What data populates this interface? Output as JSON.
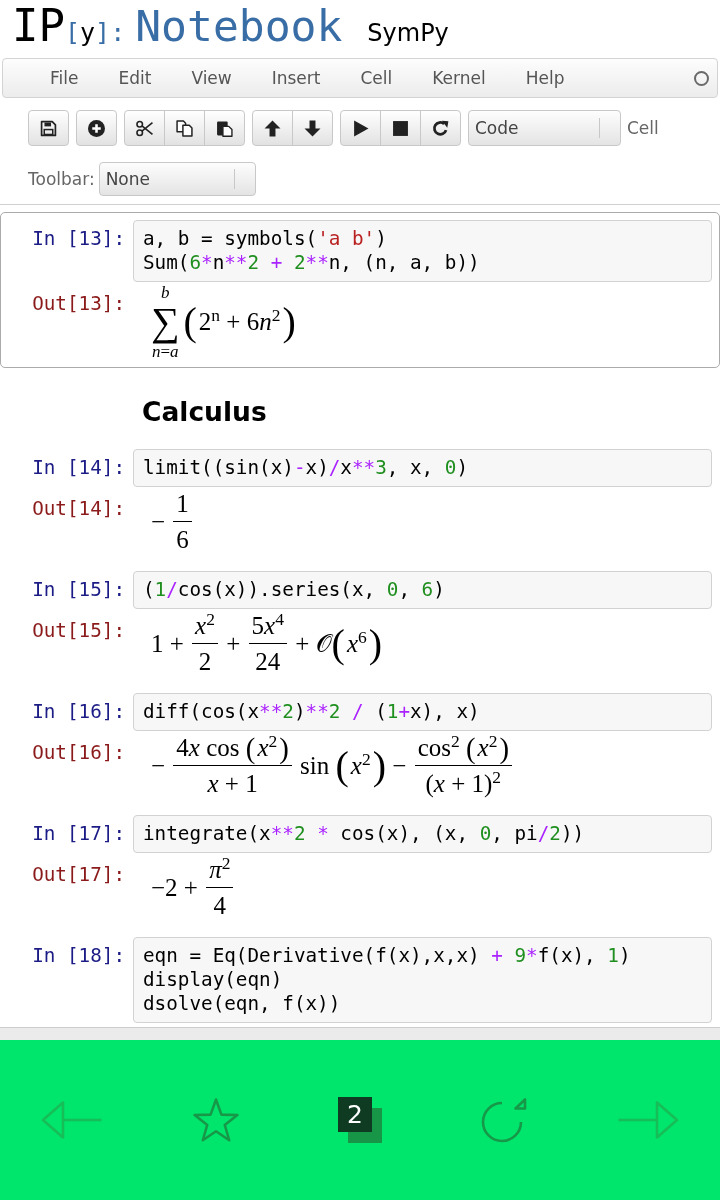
{
  "header": {
    "logo_mark": [
      {
        "kind": "ip",
        "text": "IP"
      },
      {
        "kind": "bracket",
        "text": "["
      },
      {
        "kind": "y",
        "text": "y"
      },
      {
        "kind": "bracket",
        "text": "]:"
      }
    ],
    "logo_text": "Notebook",
    "notebook_name": "SymPy"
  },
  "menu": {
    "items": [
      "File",
      "Edit",
      "View",
      "Insert",
      "Cell",
      "Kernel",
      "Help"
    ],
    "kernel_busy": false
  },
  "toolbar": {
    "groups": [
      [
        {
          "kind": "save"
        }
      ],
      [
        {
          "kind": "insert"
        }
      ],
      [
        {
          "kind": "cut"
        },
        {
          "kind": "copy"
        },
        {
          "kind": "paste"
        }
      ],
      [
        {
          "kind": "up"
        },
        {
          "kind": "down"
        }
      ],
      [
        {
          "kind": "run"
        },
        {
          "kind": "stop"
        },
        {
          "kind": "restart"
        }
      ]
    ],
    "cell_type": "Code",
    "cell_type_label": "Cell",
    "preset_label": "Toolbar:",
    "preset": "None"
  },
  "cells": [
    {
      "kind": "code",
      "selected": true,
      "prompt_in": "In [13]:",
      "code": [
        [
          {
            "kind": "name",
            "text": "a, b = symbols("
          },
          {
            "kind": "string",
            "text": "'a b'"
          },
          {
            "kind": "name",
            "text": ")"
          }
        ],
        [
          {
            "kind": "name",
            "text": "Sum("
          },
          {
            "kind": "number",
            "text": "6"
          },
          {
            "kind": "operator",
            "text": "*"
          },
          {
            "kind": "name",
            "text": "n"
          },
          {
            "kind": "operator",
            "text": "**"
          },
          {
            "kind": "number",
            "text": "2"
          },
          {
            "kind": "operator",
            "text": " + "
          },
          {
            "kind": "number",
            "text": "2"
          },
          {
            "kind": "operator",
            "text": "**"
          },
          {
            "kind": "name",
            "text": "n, (n, a, b))"
          }
        ]
      ],
      "prompt_out": "Out[13]:",
      "output": [
        {
          "kind": "sum",
          "symbol": "∑",
          "upper": "b",
          "lower": "*n*=*a*"
        },
        {
          "kind": "group",
          "open": "(",
          "close": ")",
          "body": [
            {
              "kind": "text",
              "text": "2$^{n}$ + 6"
            },
            {
              "kind": "text",
              "text": "*n*$^{2}$"
            }
          ]
        }
      ]
    },
    {
      "kind": "heading",
      "selected": false,
      "text": "Calculus"
    },
    {
      "kind": "code",
      "selected": false,
      "prompt_in": "In [14]:",
      "code": [
        [
          {
            "kind": "name",
            "text": "limit((sin(x)"
          },
          {
            "kind": "operator",
            "text": "-"
          },
          {
            "kind": "name",
            "text": "x)"
          },
          {
            "kind": "operator",
            "text": "/"
          },
          {
            "kind": "name",
            "text": "x"
          },
          {
            "kind": "operator",
            "text": "**"
          },
          {
            "kind": "number",
            "text": "3"
          },
          {
            "kind": "name",
            "text": ", x, "
          },
          {
            "kind": "number",
            "text": "0"
          },
          {
            "kind": "name",
            "text": ")"
          }
        ]
      ],
      "prompt_out": "Out[14]:",
      "output": [
        {
          "kind": "text",
          "text": "− "
        },
        {
          "kind": "frac",
          "num": [
            {
              "kind": "text",
              "text": "1"
            }
          ],
          "den": [
            {
              "kind": "text",
              "text": "6"
            }
          ]
        }
      ]
    },
    {
      "kind": "code",
      "selected": false,
      "prompt_in": "In [15]:",
      "code": [
        [
          {
            "kind": "name",
            "text": "("
          },
          {
            "kind": "number",
            "text": "1"
          },
          {
            "kind": "operator",
            "text": "/"
          },
          {
            "kind": "name",
            "text": "cos(x)).series(x, "
          },
          {
            "kind": "number",
            "text": "0"
          },
          {
            "kind": "name",
            "text": ", "
          },
          {
            "kind": "number",
            "text": "6"
          },
          {
            "kind": "name",
            "text": ")"
          }
        ]
      ],
      "prompt_out": "Out[15]:",
      "output": [
        {
          "kind": "text",
          "text": "1 + "
        },
        {
          "kind": "frac",
          "num": [
            {
              "kind": "text",
              "text": "*x*$^{2}$"
            }
          ],
          "den": [
            {
              "kind": "text",
              "text": "2"
            }
          ]
        },
        {
          "kind": "text",
          "text": " + "
        },
        {
          "kind": "frac",
          "num": [
            {
              "kind": "text",
              "text": "5"
            },
            {
              "kind": "text",
              "text": "*x*$^{4}$"
            }
          ],
          "den": [
            {
              "kind": "text",
              "text": "24"
            }
          ]
        },
        {
          "kind": "text",
          "text": " + 𝒪"
        },
        {
          "kind": "group",
          "open": "(",
          "close": ")",
          "body": [
            {
              "kind": "text",
              "text": "*x*$^{6}$"
            }
          ]
        }
      ]
    },
    {
      "kind": "code",
      "selected": false,
      "prompt_in": "In [16]:",
      "code": [
        [
          {
            "kind": "name",
            "text": "diff(cos(x"
          },
          {
            "kind": "operator",
            "text": "**"
          },
          {
            "kind": "number",
            "text": "2"
          },
          {
            "kind": "name",
            "text": ")"
          },
          {
            "kind": "operator",
            "text": "**"
          },
          {
            "kind": "number",
            "text": "2"
          },
          {
            "kind": "operator",
            "text": " / "
          },
          {
            "kind": "name",
            "text": "("
          },
          {
            "kind": "number",
            "text": "1"
          },
          {
            "kind": "operator",
            "text": "+"
          },
          {
            "kind": "name",
            "text": "x), x)"
          }
        ]
      ],
      "prompt_out": "Out[16]:",
      "output": [
        {
          "kind": "text",
          "text": "− "
        },
        {
          "kind": "frac",
          "num": [
            {
              "kind": "text",
              "text": "4"
            },
            {
              "kind": "text",
              "text": "*x* cos "
            },
            {
              "kind": "group",
              "open": "(",
              "close": ")",
              "body": [
                {
                  "kind": "text",
                  "text": "*x*$^{2}$"
                }
              ]
            }
          ],
          "den": [
            {
              "kind": "text",
              "text": "*x* + 1"
            }
          ]
        },
        {
          "kind": "text",
          "text": " sin "
        },
        {
          "kind": "group",
          "open": "(",
          "close": ")",
          "body": [
            {
              "kind": "text",
              "text": "*x*$^{2}$"
            }
          ]
        },
        {
          "kind": "text",
          "text": " − "
        },
        {
          "kind": "frac",
          "num": [
            {
              "kind": "text",
              "text": "cos$^{2}$ "
            },
            {
              "kind": "group",
              "open": "(",
              "close": ")",
              "body": [
                {
                  "kind": "text",
                  "text": "*x*$^{2}$"
                }
              ]
            }
          ],
          "den": [
            {
              "kind": "text",
              "text": "(*x* + 1)$^{2}$"
            }
          ]
        }
      ]
    },
    {
      "kind": "code",
      "selected": false,
      "prompt_in": "In [17]:",
      "code": [
        [
          {
            "kind": "name",
            "text": "integrate(x"
          },
          {
            "kind": "operator",
            "text": "**"
          },
          {
            "kind": "number",
            "text": "2"
          },
          {
            "kind": "operator",
            "text": " * "
          },
          {
            "kind": "name",
            "text": "cos(x), (x, "
          },
          {
            "kind": "number",
            "text": "0"
          },
          {
            "kind": "name",
            "text": ", pi"
          },
          {
            "kind": "operator",
            "text": "/"
          },
          {
            "kind": "number",
            "text": "2"
          },
          {
            "kind": "name",
            "text": "))"
          }
        ]
      ],
      "prompt_out": "Out[17]:",
      "output": [
        {
          "kind": "text",
          "text": "−2 + "
        },
        {
          "kind": "frac",
          "num": [
            {
              "kind": "text",
              "text": "*π*$^{2}$"
            }
          ],
          "den": [
            {
              "kind": "text",
              "text": "4"
            }
          ]
        }
      ]
    },
    {
      "kind": "code",
      "selected": false,
      "prompt_in": "In [18]:",
      "code": [
        [
          {
            "kind": "name",
            "text": "eqn = Eq(Derivative(f(x),x,x)"
          },
          {
            "kind": "operator",
            "text": " + "
          },
          {
            "kind": "number",
            "text": "9"
          },
          {
            "kind": "operator",
            "text": "*"
          },
          {
            "kind": "name",
            "text": "f(x), "
          },
          {
            "kind": "number",
            "text": "1"
          },
          {
            "kind": "name",
            "text": ")"
          }
        ],
        [
          {
            "kind": "name",
            "text": "display(eqn)"
          }
        ],
        [
          {
            "kind": "name",
            "text": "dsolve(eqn, f(x))"
          }
        ]
      ]
    }
  ],
  "browser_bar": {
    "buttons": [
      {
        "kind": "back",
        "disabled": true
      },
      {
        "kind": "bookmark",
        "disabled": false
      },
      {
        "kind": "tabs",
        "count": "2",
        "disabled": false
      },
      {
        "kind": "reload",
        "disabled": false
      },
      {
        "kind": "forward",
        "disabled": true
      }
    ]
  }
}
